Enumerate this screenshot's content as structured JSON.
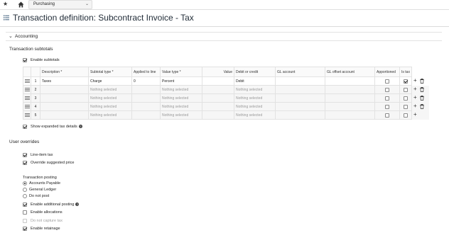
{
  "topbar": {
    "module_label": "Purchasing"
  },
  "page": {
    "title": "Transaction definition: Subcontract Invoice - Tax"
  },
  "section": {
    "label": "Accounting"
  },
  "transaction_subtotals": {
    "heading": "Transaction subtotals",
    "enable_subtotals_label": "Enable subtotals",
    "enable_subtotals_checked": true,
    "columns": [
      "Description *",
      "Subtotal type *",
      "Applied to line",
      "Value type *",
      "Value",
      "Debit or credit",
      "GL account",
      "GL offset account",
      "Apportioned",
      "Is tax"
    ],
    "rows": [
      {
        "num": "1",
        "description": "Taxes",
        "subtotal_type": "Charge",
        "applied_to_line": "0",
        "value_type": "Percent",
        "value": "",
        "debit_credit": "Debit",
        "gl_account": "",
        "gl_offset": "",
        "apportioned": false,
        "is_tax": true,
        "deletable": true
      },
      {
        "num": "2",
        "description": "",
        "subtotal_type": "Nothing selected",
        "applied_to_line": "",
        "value_type": "Nothing selected",
        "value": "",
        "debit_credit": "Nothing selected",
        "gl_account": "",
        "gl_offset": "",
        "apportioned": false,
        "is_tax": false,
        "deletable": true
      },
      {
        "num": "3",
        "description": "",
        "subtotal_type": "Nothing selected",
        "applied_to_line": "",
        "value_type": "Nothing selected",
        "value": "",
        "debit_credit": "Nothing selected",
        "gl_account": "",
        "gl_offset": "",
        "apportioned": false,
        "is_tax": false,
        "deletable": true
      },
      {
        "num": "4",
        "description": "",
        "subtotal_type": "Nothing selected",
        "applied_to_line": "",
        "value_type": "Nothing selected",
        "value": "",
        "debit_credit": "Nothing selected",
        "gl_account": "",
        "gl_offset": "",
        "apportioned": false,
        "is_tax": false,
        "deletable": true
      },
      {
        "num": "5",
        "description": "",
        "subtotal_type": "Nothing selected",
        "applied_to_line": "",
        "value_type": "Nothing selected",
        "value": "",
        "debit_credit": "Nothing selected",
        "gl_account": "",
        "gl_offset": "",
        "apportioned": false,
        "is_tax": false,
        "deletable": false
      }
    ],
    "show_expanded_label": "Show expanded tax details",
    "show_expanded_checked": true
  },
  "user_overrides": {
    "heading": "User overrides",
    "line_item_tax_label": "Line-item tax",
    "line_item_tax_checked": true,
    "override_price_label": "Override suggested price",
    "override_price_checked": true
  },
  "transaction_posting": {
    "heading": "Transaction posting",
    "options": [
      "Accounts Payable",
      "General Ledger",
      "Do not post"
    ],
    "selected_index": 0,
    "enable_additional_posting_label": "Enable additional posting",
    "enable_additional_posting_checked": true,
    "enable_allocations_label": "Enable allocations",
    "enable_allocations_checked": false,
    "do_not_capture_tax_label": "Do not capture tax",
    "do_not_capture_tax_checked": false,
    "enable_retainage_label": "Enable retainage",
    "enable_retainage_checked": true
  }
}
